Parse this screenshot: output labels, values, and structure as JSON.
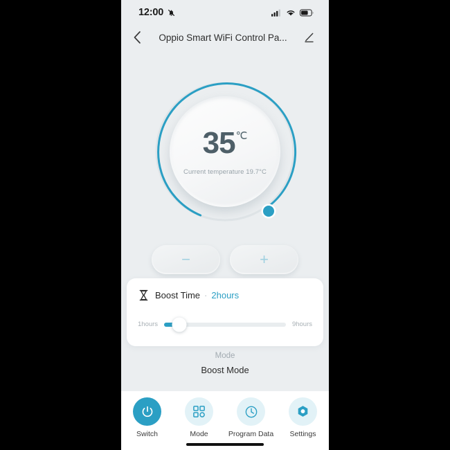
{
  "status_bar": {
    "time": "12:00",
    "mute_icon": "bell-slash-icon",
    "signal_icon": "cellular-signal-icon",
    "signal_bars_filled": 3,
    "signal_bars_total": 4,
    "wifi_icon": "wifi-icon",
    "battery_icon": "battery-icon",
    "battery_level_percent": 60
  },
  "header": {
    "back_icon": "chevron-left-icon",
    "title": "Oppio Smart WiFi Control Pa...",
    "edit_icon": "pencil-edit-icon"
  },
  "dial": {
    "target_temperature": "35",
    "unit": "℃",
    "current_temperature_label": "Current temperature 19.7°C",
    "arc_color": "#2b9fc4",
    "arc_track_color": "#dfe4e7",
    "knob_icon": "dial-handle-knob"
  },
  "stepper": {
    "minus_label": "−",
    "plus_label": "+",
    "minus_name": "decrease-temperature-button",
    "plus_name": "increase-temperature-button"
  },
  "boost_card": {
    "icon": "hourglass-icon",
    "label": "Boost Time",
    "separator": "·",
    "value": "2hours",
    "value_color": "#2b9fc4",
    "slider": {
      "min_label": "1hours",
      "max_label": "9hours",
      "min": 1,
      "max": 9,
      "value": 2,
      "fill_color": "#2b9fc4"
    }
  },
  "mode": {
    "caption": "Mode",
    "name": "Boost Mode"
  },
  "bottom_nav": {
    "items": [
      {
        "label": "Switch",
        "icon": "power-icon",
        "active": true
      },
      {
        "label": "Mode",
        "icon": "grid-icon",
        "active": false
      },
      {
        "label": "Program Data",
        "icon": "clock-icon",
        "active": false
      },
      {
        "label": "Settings",
        "icon": "hex-gear-icon",
        "active": false
      }
    ],
    "active_color": "#2b9fc4",
    "inactive_bg": "#e2f2f7"
  }
}
